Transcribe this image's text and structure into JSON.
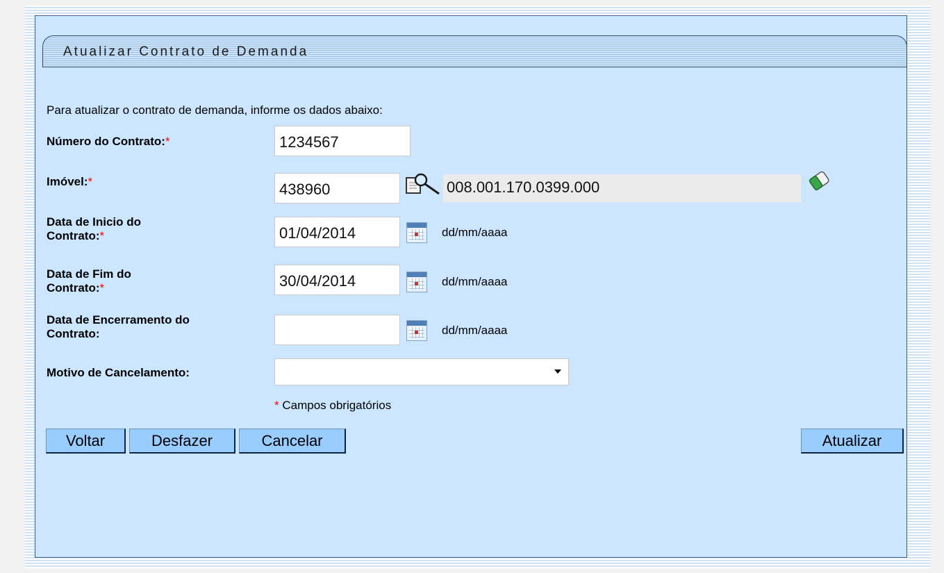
{
  "title": "Atualizar Contrato de Demanda",
  "instructions": "Para atualizar o contrato de demanda, informe os dados abaixo:",
  "fields": {
    "numero_contrato": {
      "label": "Número do Contrato:",
      "required_mark": "*",
      "value": "1234567"
    },
    "imovel": {
      "label": "Imóvel:",
      "required_mark": "*",
      "value": "438960",
      "inscricao": "008.001.170.0399.000"
    },
    "data_inicio": {
      "label_line1": "Data de Inicio do",
      "label_line2": "Contrato:",
      "required_mark": "*",
      "value": "01/04/2014",
      "format_hint": "dd/mm/aaaa"
    },
    "data_fim": {
      "label_line1": "Data de Fim do",
      "label_line2": "Contrato:",
      "required_mark": "*",
      "value": "30/04/2014",
      "format_hint": "dd/mm/aaaa"
    },
    "data_encerramento": {
      "label_line1": "Data de Encerramento do",
      "label_line2": "Contrato:",
      "value": "",
      "format_hint": "dd/mm/aaaa"
    },
    "motivo_cancelamento": {
      "label": "Motivo de Cancelamento:",
      "selected": ""
    }
  },
  "required_note": {
    "mark": "*",
    "text": " Campos obrigatórios"
  },
  "buttons": {
    "voltar": "Voltar",
    "desfazer": "Desfazer",
    "cancelar": "Cancelar",
    "atualizar": "Atualizar"
  },
  "icons": {
    "search": "magnifier-document-icon",
    "clear": "eraser-icon",
    "calendar": "calendar-icon"
  }
}
